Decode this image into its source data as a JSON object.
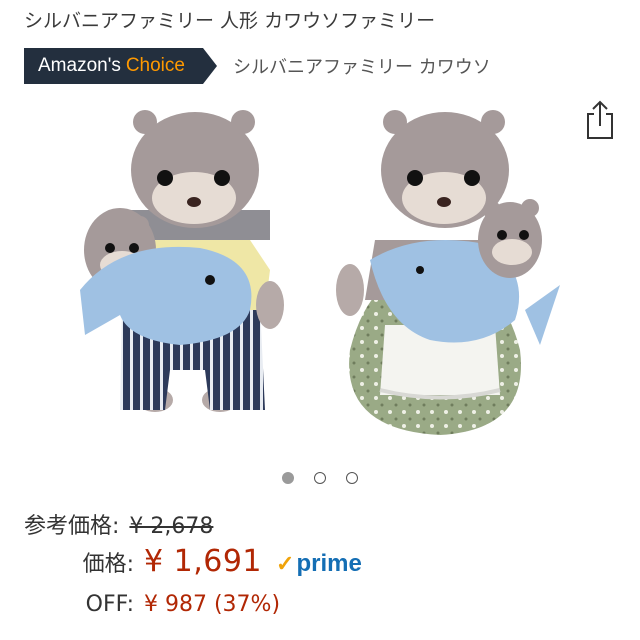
{
  "product": {
    "title": "シルバニアファミリー 人形 カワウソファミリー",
    "badge_prefix": "Amazon's",
    "badge_highlight": "Choice",
    "badge_subtitle": "シルバニアファミリー カワウソ"
  },
  "carousel": {
    "total": 3,
    "active_index": 0
  },
  "pricing": {
    "list_label": "参考価格:",
    "list_price": "¥ 2,678",
    "price_label": "価格:",
    "price": "¥ 1,691",
    "prime_check": "✓",
    "prime_label": "prime",
    "savings_label": "OFF:",
    "savings": "¥ 987 (37%)"
  },
  "icons": {
    "share": "share-icon"
  },
  "colors": {
    "badge_bg": "#232f3e",
    "badge_highlight": "#ff9900",
    "price": "#b12704",
    "prime": "#146eb4",
    "prime_check": "#f0a30a"
  }
}
